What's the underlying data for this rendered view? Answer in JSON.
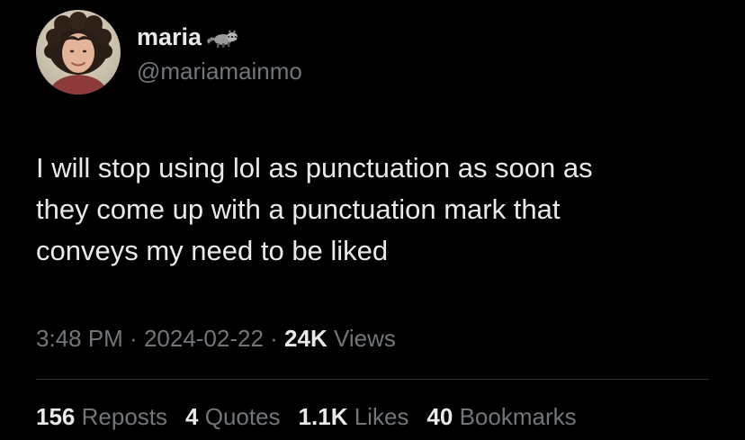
{
  "author": {
    "display_name": "maria",
    "emoji": "raccoon-icon",
    "handle": "@mariamainmo"
  },
  "tweet": {
    "text": "I will stop using lol as punctuation as soon as\nthey come up with a punctuation mark that\nconveys my need to be liked"
  },
  "meta": {
    "time": "3:48 PM",
    "separator1": " · ",
    "date": "2024-02-22",
    "separator2": " · ",
    "views_count": "24K",
    "views_label": "Views"
  },
  "stats": {
    "reposts_count": "156",
    "reposts_label": "Reposts",
    "quotes_count": "4",
    "quotes_label": "Quotes",
    "likes_count": "1.1K",
    "likes_label": "Likes",
    "bookmarks_count": "40",
    "bookmarks_label": "Bookmarks"
  },
  "colors": {
    "background": "#000000",
    "primary_text": "#e7e9ea",
    "secondary_text": "#71767b",
    "divider": "#2f3336"
  }
}
